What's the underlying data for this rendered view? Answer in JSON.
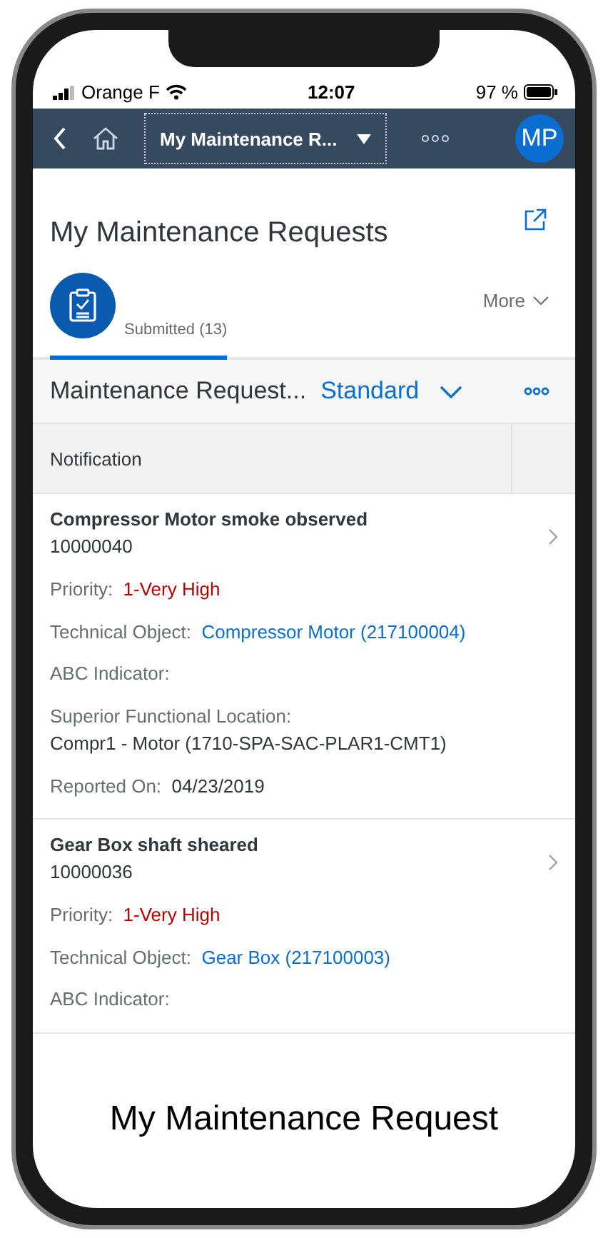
{
  "status_bar": {
    "carrier": "Orange F",
    "time": "12:07",
    "battery": "97 %"
  },
  "shell_bar": {
    "title": "My Maintenance R...",
    "avatar": "MP"
  },
  "page": {
    "title": "My Maintenance Requests"
  },
  "tabs": [
    {
      "label": "Submitted (13)",
      "selected": true
    }
  ],
  "more": "More",
  "table_toolbar": {
    "title": "Maintenance Request...",
    "variant": "Standard"
  },
  "table": {
    "columns": [
      "Notification"
    ],
    "rows": [
      {
        "title": "Compressor Motor smoke observed",
        "number": "10000040",
        "fields": [
          {
            "kind": "critical",
            "label": "Priority:",
            "value": "1-Very High"
          },
          {
            "kind": "link",
            "label": "Technical Object:",
            "value": "Compressor Motor (217100004)"
          },
          {
            "kind": "inline",
            "label": "ABC Indicator:"
          },
          {
            "kind": "stacked",
            "label": "Superior Functional Location:",
            "value": "Compr1 - Motor (1710-SPA-SAC-PLAR1-CMT1)"
          },
          {
            "kind": "inline",
            "label": "Reported On:",
            "value": "04/23/2019"
          }
        ]
      },
      {
        "title": "Gear Box shaft sheared",
        "number": "10000036",
        "fields": [
          {
            "kind": "critical",
            "label": "Priority:",
            "value": "1-Very High"
          },
          {
            "kind": "link",
            "label": "Technical Object:",
            "value": "Gear Box (217100003)"
          },
          {
            "kind": "inline",
            "label": "ABC Indicator:"
          }
        ]
      }
    ]
  },
  "caption": "My Maintenance Request"
}
